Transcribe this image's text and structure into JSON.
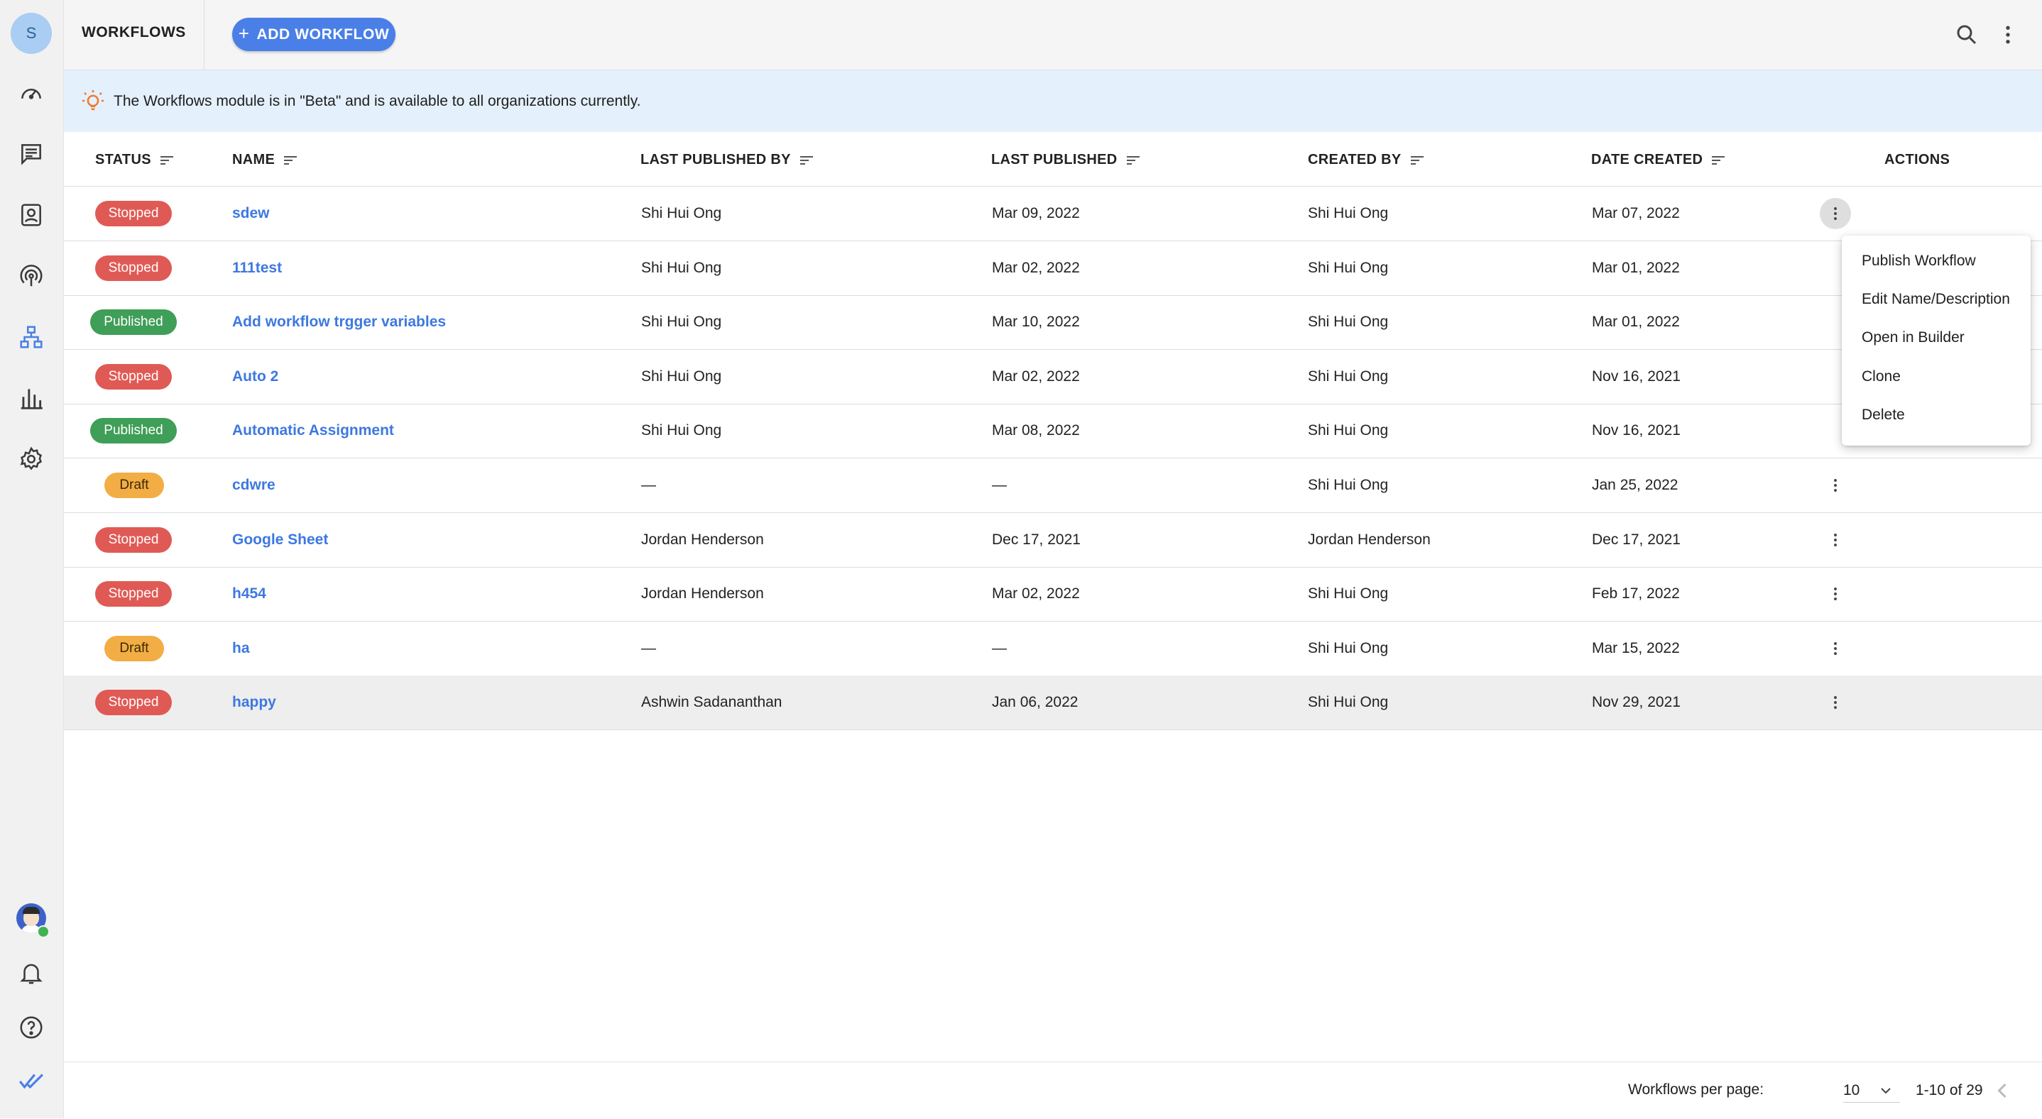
{
  "sidebar": {
    "avatar_letter": "S",
    "nav": [
      "dashboard-icon",
      "messages-icon",
      "contacts-icon",
      "broadcast-icon",
      "workflows-icon",
      "reports-icon",
      "settings-icon"
    ],
    "bottom": [
      "user-avatar",
      "notifications-icon",
      "help-icon",
      "brand-logo-icon"
    ],
    "active_color": "#4a7fe8"
  },
  "header": {
    "title": "WORKFLOWS",
    "add_button": "ADD WORKFLOW",
    "add_button_icon": "+"
  },
  "banner": {
    "text": "The Workflows module is in \"Beta\" and is available to all organizations currently."
  },
  "table": {
    "columns": [
      "STATUS",
      "NAME",
      "LAST PUBLISHED BY",
      "LAST PUBLISHED",
      "CREATED BY",
      "DATE CREATED",
      "ACTIONS"
    ],
    "rows": [
      {
        "status": "Stopped",
        "name": "sdew",
        "last_published_by": "Shi Hui Ong",
        "last_published": "Mar 09, 2022",
        "created_by": "Shi Hui Ong",
        "date_created": "Mar 07, 2022"
      },
      {
        "status": "Stopped",
        "name": "111test",
        "last_published_by": "Shi Hui Ong",
        "last_published": "Mar 02, 2022",
        "created_by": "Shi Hui Ong",
        "date_created": "Mar 01, 2022"
      },
      {
        "status": "Published",
        "name": "Add workflow trgger variables",
        "last_published_by": "Shi Hui Ong",
        "last_published": "Mar 10, 2022",
        "created_by": "Shi Hui Ong",
        "date_created": "Mar 01, 2022"
      },
      {
        "status": "Stopped",
        "name": "Auto 2",
        "last_published_by": "Shi Hui Ong",
        "last_published": "Mar 02, 2022",
        "created_by": "Shi Hui Ong",
        "date_created": "Nov 16, 2021"
      },
      {
        "status": "Published",
        "name": "Automatic Assignment",
        "last_published_by": "Shi Hui Ong",
        "last_published": "Mar 08, 2022",
        "created_by": "Shi Hui Ong",
        "date_created": "Nov 16, 2021"
      },
      {
        "status": "Draft",
        "name": "cdwre",
        "last_published_by": "—",
        "last_published": "—",
        "created_by": "Shi Hui Ong",
        "date_created": "Jan 25, 2022"
      },
      {
        "status": "Stopped",
        "name": "Google Sheet",
        "last_published_by": "Jordan Henderson",
        "last_published": "Dec 17, 2021",
        "created_by": "Jordan Henderson",
        "date_created": "Dec 17, 2021"
      },
      {
        "status": "Stopped",
        "name": "h454",
        "last_published_by": "Jordan Henderson",
        "last_published": "Mar 02, 2022",
        "created_by": "Shi Hui Ong",
        "date_created": "Feb 17, 2022"
      },
      {
        "status": "Draft",
        "name": "ha",
        "last_published_by": "—",
        "last_published": "—",
        "created_by": "Shi Hui Ong",
        "date_created": "Mar 15, 2022"
      },
      {
        "status": "Stopped",
        "name": "happy",
        "last_published_by": "Ashwin Sadananthan",
        "last_published": "Jan 06, 2022",
        "created_by": "Shi Hui Ong",
        "date_created": "Nov 29, 2021"
      }
    ]
  },
  "actions_menu": {
    "items": [
      "Publish Workflow",
      "Edit Name/Description",
      "Open in Builder",
      "Clone",
      "Delete"
    ]
  },
  "footer": {
    "per_page_label": "Workflows per page:",
    "per_page_value": "10",
    "range": "1-10 of 29"
  },
  "colors": {
    "stopped": "#e05a55",
    "published": "#3f9e57",
    "draft": "#f3ad45",
    "link": "#3d78e0",
    "banner_bg": "#e4f0fb"
  }
}
